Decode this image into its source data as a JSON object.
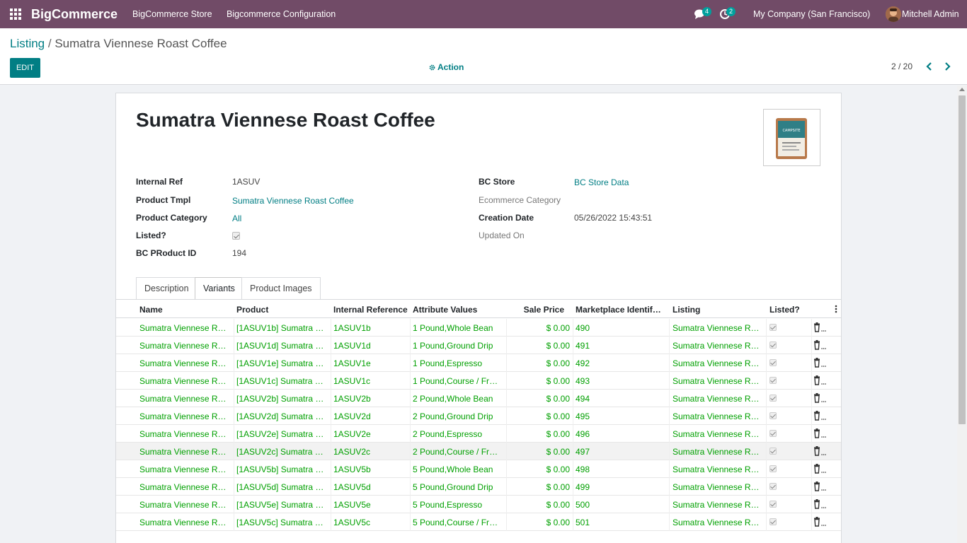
{
  "app": {
    "brand": "BigCommerce",
    "menu": [
      "BigCommerce Store",
      "Bigcommerce Configuration"
    ],
    "messages_count": "4",
    "activities_count": "2",
    "company": "My Company (San Francisco)",
    "user": "Mitchell Admin"
  },
  "breadcrumb": {
    "parent": "Listing",
    "separator": "/",
    "current": "Sumatra Viennese Roast Coffee"
  },
  "toolbar": {
    "edit_label": "EDIT",
    "action_label": "Action",
    "pager": "2 / 20"
  },
  "form": {
    "title": "Sumatra Viennese Roast Coffee",
    "left_fields": [
      {
        "label": "Internal Ref",
        "value": "1ASUV"
      },
      {
        "label": "Product Tmpl",
        "value": "Sumatra Viennese Roast Coffee"
      },
      {
        "label": "Product Category",
        "value": "All"
      },
      {
        "label": "Listed?",
        "value": ""
      },
      {
        "label": "BC PRoduct ID",
        "value": "194"
      }
    ],
    "right_fields": [
      {
        "label": "BC Store",
        "value": "BC Store Data"
      },
      {
        "label": "Ecommerce Category",
        "value": ""
      },
      {
        "label": "Creation Date",
        "value": "05/26/2022 15:43:51"
      },
      {
        "label": "Updated On",
        "value": ""
      }
    ]
  },
  "tabs": [
    "Description",
    "Variants",
    "Product Images"
  ],
  "table": {
    "headers": [
      "Name",
      "Product",
      "Internal Reference",
      "Attribute Values",
      "Sale Price",
      "Marketplace Identific...",
      "Listing",
      "Listed?"
    ],
    "rows": [
      [
        "Sumatra Viennese Roa...",
        "[1ASUV1b] Sumatra Vie...",
        "1ASUV1b",
        "1 Pound,Whole Bean",
        "$ 0.00",
        "490",
        "Sumatra Viennese Roa..."
      ],
      [
        "Sumatra Viennese Roa...",
        "[1ASUV1d] Sumatra Vi...",
        "1ASUV1d",
        "1 Pound,Ground Drip",
        "$ 0.00",
        "491",
        "Sumatra Viennese Roa..."
      ],
      [
        "Sumatra Viennese Roa...",
        "[1ASUV1e] Sumatra Vie...",
        "1ASUV1e",
        "1 Pound,Espresso",
        "$ 0.00",
        "492",
        "Sumatra Viennese Roa..."
      ],
      [
        "Sumatra Viennese Roa...",
        "[1ASUV1c] Sumatra Vie...",
        "1ASUV1c",
        "1 Pound,Course / Fren...",
        "$ 0.00",
        "493",
        "Sumatra Viennese Roa..."
      ],
      [
        "Sumatra Viennese Roa...",
        "[1ASUV2b] Sumatra Vie...",
        "1ASUV2b",
        "2 Pound,Whole Bean",
        "$ 0.00",
        "494",
        "Sumatra Viennese Roa..."
      ],
      [
        "Sumatra Viennese Roa...",
        "[1ASUV2d] Sumatra Vi...",
        "1ASUV2d",
        "2 Pound,Ground Drip",
        "$ 0.00",
        "495",
        "Sumatra Viennese Roa..."
      ],
      [
        "Sumatra Viennese Roa...",
        "[1ASUV2e] Sumatra Vie...",
        "1ASUV2e",
        "2 Pound,Espresso",
        "$ 0.00",
        "496",
        "Sumatra Viennese Roa..."
      ],
      [
        "Sumatra Viennese Roa...",
        "[1ASUV2c] Sumatra Vie...",
        "1ASUV2c",
        "2 Pound,Course / Fren...",
        "$ 0.00",
        "497",
        "Sumatra Viennese Roa..."
      ],
      [
        "Sumatra Viennese Roa...",
        "[1ASUV5b] Sumatra Vie...",
        "1ASUV5b",
        "5 Pound,Whole Bean",
        "$ 0.00",
        "498",
        "Sumatra Viennese Roa..."
      ],
      [
        "Sumatra Viennese Roa...",
        "[1ASUV5d] Sumatra Vi...",
        "1ASUV5d",
        "5 Pound,Ground Drip",
        "$ 0.00",
        "499",
        "Sumatra Viennese Roa..."
      ],
      [
        "Sumatra Viennese Roa...",
        "[1ASUV5e] Sumatra Vie...",
        "1ASUV5e",
        "5 Pound,Espresso",
        "$ 0.00",
        "500",
        "Sumatra Viennese Roa..."
      ],
      [
        "Sumatra Viennese Roa...",
        "[1ASUV5c] Sumatra Vie...",
        "1ASUV5c",
        "5 Pound,Course / Fren...",
        "$ 0.00",
        "501",
        "Sumatra Viennese Roa..."
      ]
    ]
  },
  "colors": {
    "navbar": "#714b67",
    "primary": "#017e84",
    "row_text": "#00a000",
    "badge": "#00a09d"
  },
  "icons": {
    "apps": "apps-grid-icon",
    "messages": "chat-icon",
    "activities": "clock-icon",
    "action": "gear-icon",
    "prev": "chevron-left-icon",
    "next": "chevron-right-icon",
    "delete": "trash-icon",
    "options": "kebab-icon"
  }
}
